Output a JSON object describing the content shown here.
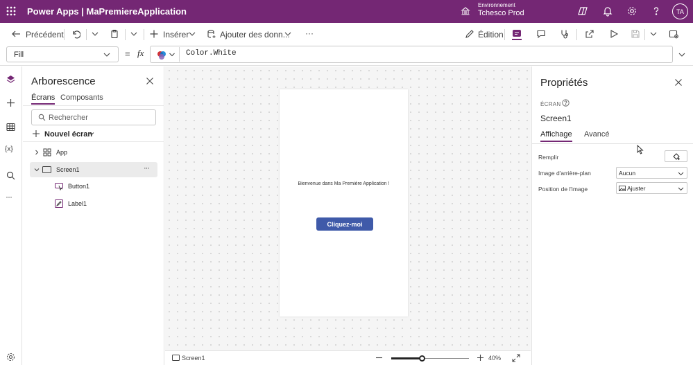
{
  "header": {
    "app_title": "Power Apps  |  MaPremiereApplication",
    "environment_label": "Environnement",
    "environment_name": "Tchesco Prod",
    "avatar_initials": "TA",
    "brand_color": "#742774"
  },
  "toolbar": {
    "back_label": "Précédent",
    "insert_label": "Insérer",
    "add_data_label": "Ajouter des donn...",
    "more_label": "···",
    "edit_label": "Édition"
  },
  "formula": {
    "property": "Fill",
    "equals": "=",
    "fx": "fx",
    "value": "Color.White"
  },
  "tree": {
    "title": "Arborescence",
    "tabs": [
      "Écrans",
      "Composants"
    ],
    "search_placeholder": "Rechercher",
    "new_screen_label": "Nouvel écran",
    "items": [
      {
        "label": "App"
      },
      {
        "label": "Screen1",
        "more": "···"
      },
      {
        "label": "Button1"
      },
      {
        "label": "Label1"
      }
    ]
  },
  "canvas": {
    "welcome_text": "Bienvenue dans Ma Première Application !",
    "button_label": "Cliquez-moi",
    "button_color": "#3f5aa9"
  },
  "statusbar": {
    "screen_name": "Screen1",
    "zoom_label": "40%",
    "zoom_level": 0.4
  },
  "properties": {
    "title": "Propriétés",
    "type_label": "ÉCRAN",
    "control_name": "Screen1",
    "tabs": [
      "Affichage",
      "Avancé"
    ],
    "fields": [
      {
        "label": "Remplir"
      },
      {
        "label": "Image d'arrière-plan",
        "value": "Aucun"
      },
      {
        "label": "Position de l'image",
        "value": "Ajuster"
      }
    ]
  }
}
